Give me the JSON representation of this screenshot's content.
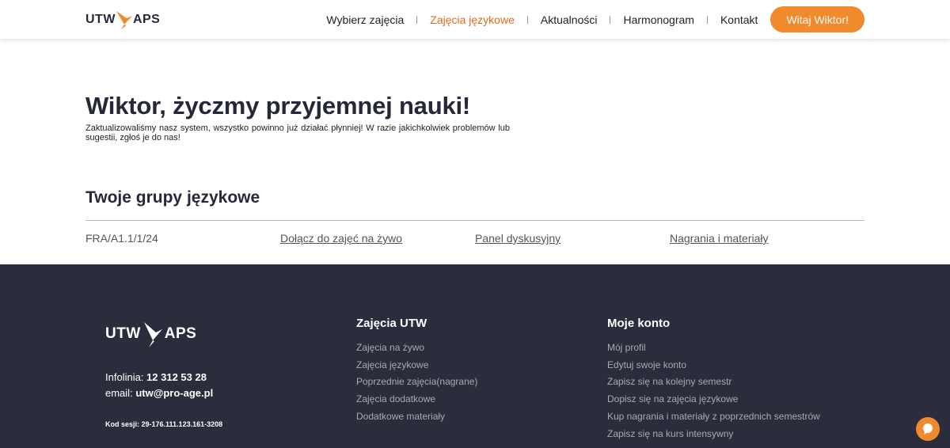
{
  "brand": {
    "left": "UTW",
    "right": "APS",
    "accent": "#f08a2d"
  },
  "nav": {
    "items": [
      {
        "label": "Wybierz zajęcia",
        "active": false
      },
      {
        "label": "Zajęcia językowe",
        "active": true
      },
      {
        "label": "Aktualności",
        "active": false
      },
      {
        "label": "Harmonogram",
        "active": false
      },
      {
        "label": "Kontakt",
        "active": false
      }
    ],
    "cta": "Witaj Wiktor!"
  },
  "main": {
    "welcome": "Wiktor, życzmy przyjemnej nauki!",
    "notice": "Zaktualizowaliśmy nasz system, wszystko powinno już działać płynniej! W razie jakichkolwiek problemów lub sugestii, zgłoś je do nas!",
    "section_title": "Twoje grupy językowe",
    "groups": [
      {
        "code": "FRA/A1.1/1/24",
        "join": "Dołącz do zajęć na żywo",
        "forum": "Panel dyskusyjny",
        "materials": "Nagrania i materiały"
      }
    ]
  },
  "footer": {
    "brand_left": "UTW",
    "brand_right": "APS",
    "hotline_label": "Infolinia:",
    "hotline": "12 312 53 28",
    "email_label": "email:",
    "email": "utw@pro-age.pl",
    "session": "Kod sesji: 29-176.111.123.161-3208",
    "col1": {
      "title": "Zajęcia UTW",
      "links": [
        "Zajęcia na żywo",
        "Zajęcia językowe",
        "Poprzednie zajęcia(nagrane)",
        "Zajęcia dodatkowe",
        "Dodatkowe materiały"
      ]
    },
    "col2": {
      "title": "Moje konto",
      "links": [
        "Mój profil",
        "Edytuj swoje konto",
        "Zapisz się na kolejny semestr",
        "Dopisz się na zajęcia językowe",
        "Kup nagrania i materiały z poprzednich semestrów",
        "Zapisz się na kurs intensywny"
      ]
    }
  },
  "chat": {
    "icon": "chat-bubble-icon"
  }
}
